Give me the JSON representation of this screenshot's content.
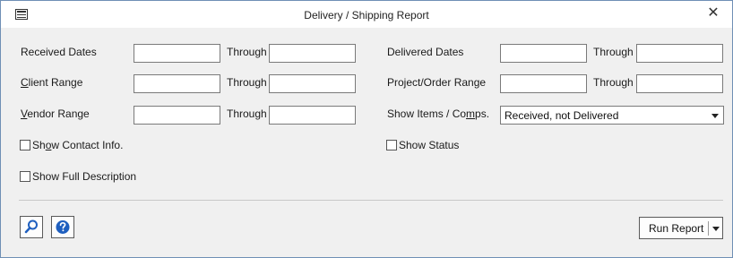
{
  "window": {
    "title": "Delivery / Shipping Report",
    "close_glyph": "✕"
  },
  "left": {
    "received_dates": "Received Dates",
    "client_range_first": "C",
    "client_range_rest": "lient Range",
    "vendor_range_first": "V",
    "vendor_range_rest": "endor Range",
    "through": "Through",
    "show_contact_pre": "Sh",
    "show_contact_u": "o",
    "show_contact_post": "w Contact Info.",
    "show_full_description": "Show Full Description"
  },
  "right": {
    "delivered_dates": "Delivered Dates",
    "project_order_range": "Project/Order Range",
    "show_items_pre": "Show Items / Co",
    "show_items_u": "m",
    "show_items_post": "ps.",
    "through": "Through",
    "show_items_selected": "Received, not Delivered",
    "show_status": "Show Status"
  },
  "fields": {
    "received_from": "",
    "received_through": "",
    "client_from": "",
    "client_through": "",
    "vendor_from": "",
    "vendor_through": "",
    "delivered_from": "",
    "delivered_through": "",
    "project_from": "",
    "project_through": ""
  },
  "checkboxes": {
    "show_contact": false,
    "show_full_description": false,
    "show_status": false
  },
  "footer": {
    "run_report": "Run Report"
  },
  "icons": {
    "search": "magnifier-icon",
    "help": "help-icon"
  },
  "colors": {
    "accent_blue": "#1f5fbf",
    "border": "#7a7a7a",
    "window_border": "#6f8fb5"
  }
}
